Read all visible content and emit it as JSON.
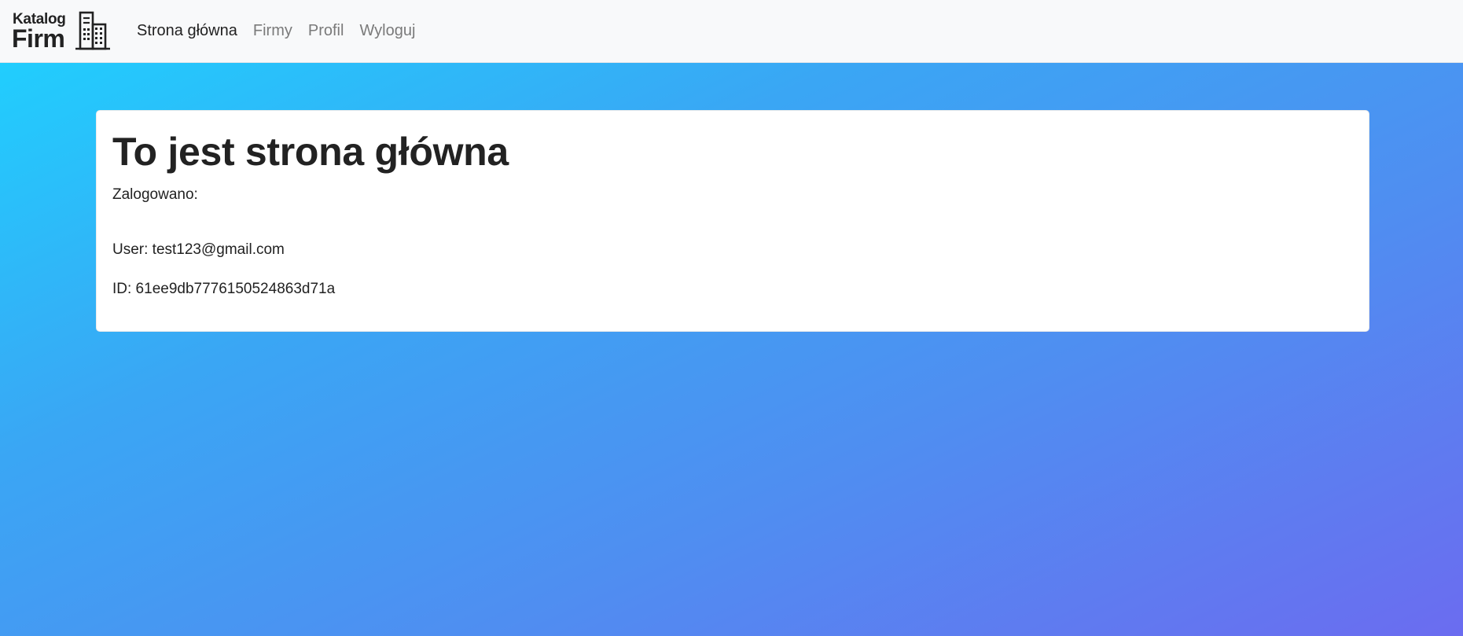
{
  "brand": {
    "line1": "Katalog",
    "line2": "Firm",
    "icon": "office-building-icon"
  },
  "nav": {
    "items": [
      {
        "label": "Strona główna",
        "active": true
      },
      {
        "label": "Firmy",
        "active": false
      },
      {
        "label": "Profil",
        "active": false
      },
      {
        "label": "Wyloguj",
        "active": false
      }
    ]
  },
  "main": {
    "title": "To jest strona główna",
    "logged_label": "Zalogowano:",
    "user_line": "User: test123@gmail.com",
    "id_line": "ID: 61ee9db7776150524863d71a"
  },
  "colors": {
    "navbar_bg": "#f8f9fa",
    "gradient_start": "#1dd4ff",
    "gradient_end": "#6b6cf0",
    "text_dark": "#222222",
    "nav_inactive": "#7a7a7a"
  }
}
